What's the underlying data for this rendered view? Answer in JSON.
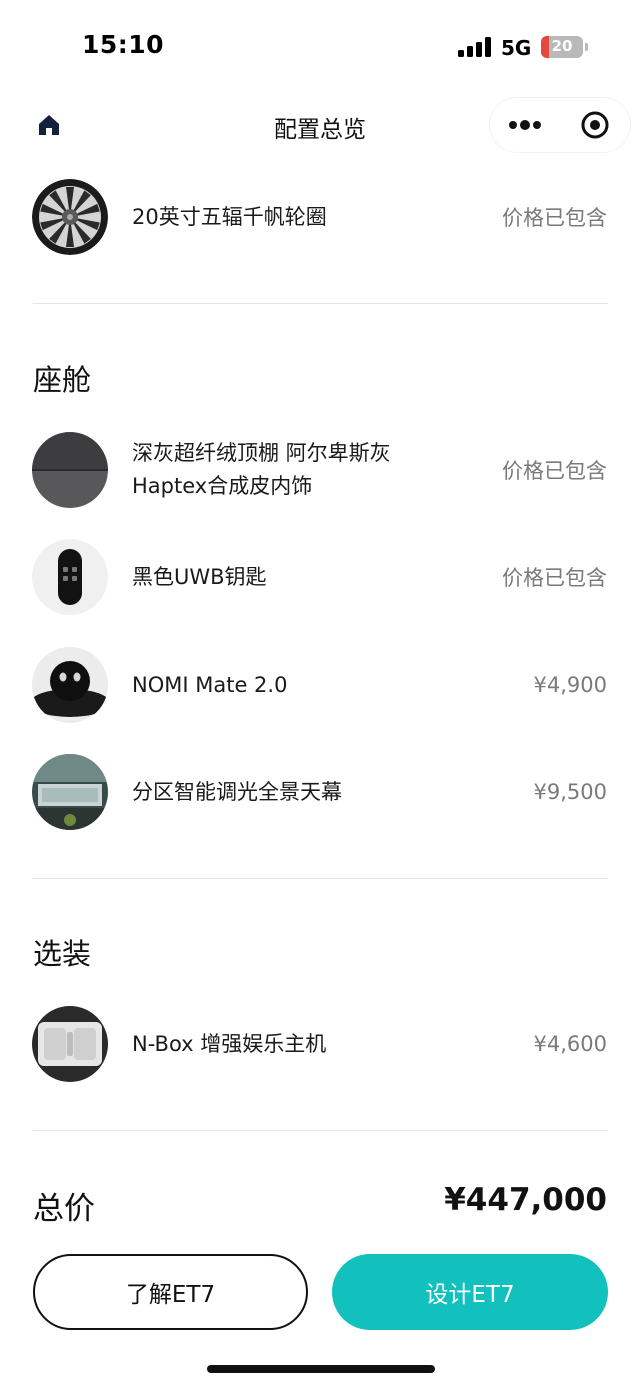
{
  "status": {
    "time": "15:10",
    "network": "5G",
    "battery": "20",
    "battery_level": 0.2,
    "battery_color": "#e4483d"
  },
  "nav": {
    "title": "配置总览",
    "home_icon": "home-icon",
    "more_icon": "more-dots-icon",
    "close_icon": "target-circle-icon"
  },
  "wheel": {
    "name": "20英寸五辐千帆轮圈",
    "price": "价格已包含"
  },
  "cabin": {
    "title": "座舱",
    "items": [
      {
        "name": "深灰超纤绒顶棚 阿尔卑斯灰 Haptex合成皮内饰",
        "price": "价格已包含"
      },
      {
        "name": "黑色UWB钥匙",
        "price": "价格已包含"
      },
      {
        "name": "NOMI Mate 2.0",
        "price": "¥4,900"
      },
      {
        "name": "分区智能调光全景天幕",
        "price": "¥9,500"
      }
    ]
  },
  "options": {
    "title": "选装",
    "items": [
      {
        "name": "N-Box 增强娱乐主机",
        "price": "¥4,600"
      }
    ]
  },
  "total": {
    "label": "总价",
    "value": "¥447,000"
  },
  "buttons": {
    "learn": "了解ET7",
    "design": "设计ET7"
  },
  "colors": {
    "accent": "#12c1bd",
    "price_gray": "#7a7a7a",
    "text": "#111111"
  }
}
